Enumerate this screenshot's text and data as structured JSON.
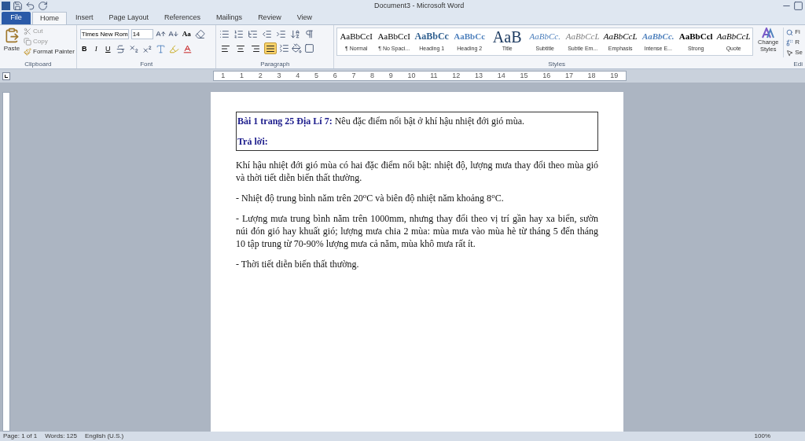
{
  "window": {
    "title": "Document3 - Microsoft Word"
  },
  "tabs": [
    {
      "label": "File",
      "kind": "file",
      "selected": false
    },
    {
      "label": "Home",
      "kind": "tab",
      "selected": true
    },
    {
      "label": "Insert",
      "kind": "tab",
      "selected": false
    },
    {
      "label": "Page Layout",
      "kind": "tab",
      "selected": false
    },
    {
      "label": "References",
      "kind": "tab",
      "selected": false
    },
    {
      "label": "Mailings",
      "kind": "tab",
      "selected": false
    },
    {
      "label": "Review",
      "kind": "tab",
      "selected": false
    },
    {
      "label": "View",
      "kind": "tab",
      "selected": false
    }
  ],
  "clipboard": {
    "paste": "Paste",
    "cut": "Cut",
    "copy": "Copy",
    "format_painter": "Format Painter",
    "group": "Clipboard"
  },
  "font": {
    "name": "Times New Rom",
    "size": "14",
    "change_case": "Aa",
    "bold": "B",
    "italic": "I",
    "underline": "U",
    "group": "Font"
  },
  "paragraph": {
    "group": "Paragraph",
    "align_buttons": [
      {
        "kind": "left",
        "selected": false
      },
      {
        "kind": "center",
        "selected": false
      },
      {
        "kind": "right",
        "selected": false
      },
      {
        "kind": "justify",
        "selected": true
      }
    ]
  },
  "styles": {
    "group": "Styles",
    "change_styles": "Change Styles",
    "items": [
      {
        "sample": "AaBbCcI",
        "name": "¶ Normal",
        "kind": "normal"
      },
      {
        "sample": "AaBbCcI",
        "name": "¶ No Spaci...",
        "kind": "normal"
      },
      {
        "sample": "AaBbCc",
        "name": "Heading 1",
        "kind": "heading1"
      },
      {
        "sample": "AaBbCc",
        "name": "Heading 2",
        "kind": "heading2"
      },
      {
        "sample": "AaB",
        "name": "Title",
        "kind": "title"
      },
      {
        "sample": "AaBbCc.",
        "name": "Subtitle",
        "kind": "subtitle"
      },
      {
        "sample": "AaBbCcL",
        "name": "Subtle Em...",
        "kind": "subtle"
      },
      {
        "sample": "AaBbCcL",
        "name": "Emphasis",
        "kind": "emphasis"
      },
      {
        "sample": "AaBbCc.",
        "name": "Intense E...",
        "kind": "intense"
      },
      {
        "sample": "AaBbCcl",
        "name": "Strong",
        "kind": "strong"
      },
      {
        "sample": "AaBbCcL",
        "name": "Quote",
        "kind": "quote"
      }
    ]
  },
  "editing": {
    "items": [
      "Fi",
      "R",
      "Se"
    ],
    "group": "Edi"
  },
  "ruler": {
    "marks": [
      "1",
      "1",
      "2",
      "3",
      "4",
      "5",
      "6",
      "7",
      "8",
      "9",
      "10",
      "11",
      "12",
      "13",
      "14",
      "15",
      "16",
      "17",
      "18",
      "19"
    ]
  },
  "document": {
    "boxed": [
      {
        "text": "**Bài 1 trang 25 Địa Lí 7:** Nêu đặc điểm nổi bật ở khí hậu nhiệt đới gió mùa."
      },
      {
        "text": "**Trả lời:**"
      }
    ],
    "paragraphs": [
      "Khí hậu nhiệt đới gió mùa có hai đặc điểm nổi bật: nhiệt độ, lượng mưa thay đổi theo mùa gió và thời tiết diễn biến thất thường.",
      "- Nhiệt độ trung bình năm trên 20$^{o}$C và biên độ nhiệt năm khoảng 8$^{o}$C.",
      "- Lượng mưa trung bình năm trên 1000mm, nhưng thay đổi theo vị trí gần hay xa biển, sườn núi đón gió hay khuất gió; lượng mưa chia 2 mùa: mùa mưa vào mùa hè từ tháng 5 đến tháng 10 tập trung từ 70-90% lượng mưa cả năm, mùa khô mưa rất ít.",
      "- Thời tiết diễn biến thất thường."
    ]
  },
  "status_bar": {
    "page": "Page: 1 of 1",
    "words": "Words: 125",
    "language": "English (U.S.)",
    "zoom": "100%"
  }
}
